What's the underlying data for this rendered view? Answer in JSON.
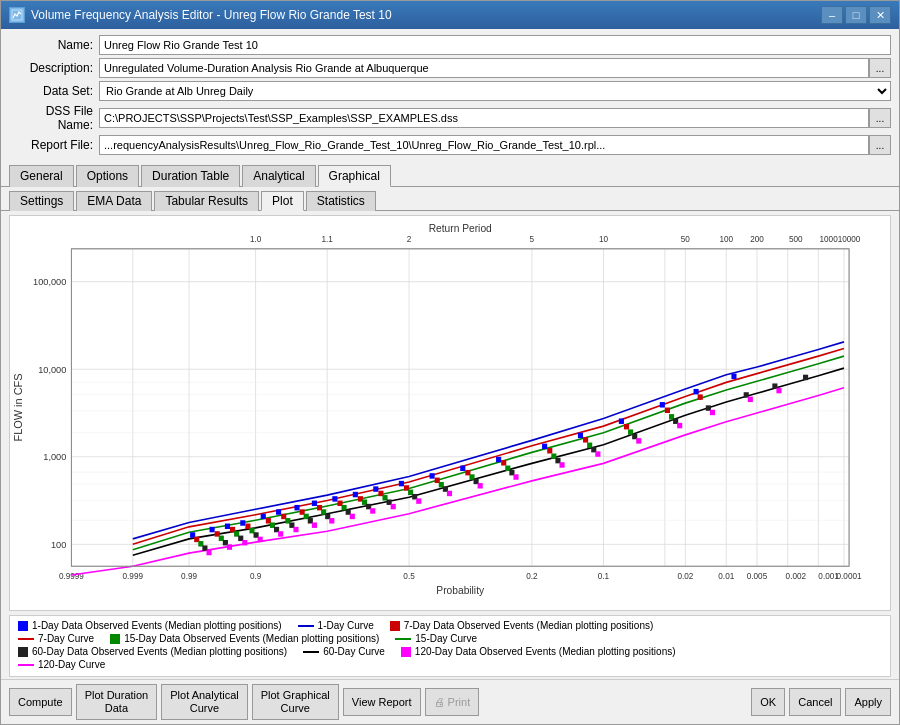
{
  "window": {
    "title": "Volume Frequency Analysis Editor - Unreg Flow Rio Grande Test 10",
    "icon": "chart-icon"
  },
  "form": {
    "name_label": "Name:",
    "name_value": "Unreg Flow Rio Grande Test 10",
    "description_label": "Description:",
    "description_value": "Unregulated Volume-Duration Analysis Rio Grande at Albuquerque",
    "dataset_label": "Data Set:",
    "dataset_value": "Rio Grande at Alb Unreg Daily",
    "dss_label": "DSS File Name:",
    "dss_value": "C:\\PROJECTS\\SSP\\Projects\\Test\\SSP_Examples\\SSP_EXAMPLES.dss",
    "report_label": "Report File:",
    "report_value": "...requencyAnalysisResults\\Unreg_Flow_Rio_Grande_Test_10\\Unreg_Flow_Rio_Grande_Test_10.rpl..."
  },
  "tabs": {
    "main": [
      {
        "id": "general",
        "label": "General"
      },
      {
        "id": "options",
        "label": "Options"
      },
      {
        "id": "duration",
        "label": "Duration Table"
      },
      {
        "id": "analytical",
        "label": "Analytical"
      },
      {
        "id": "graphical",
        "label": "Graphical",
        "active": true
      }
    ],
    "sub": [
      {
        "id": "settings",
        "label": "Settings"
      },
      {
        "id": "ema",
        "label": "EMA Data"
      },
      {
        "id": "tabular",
        "label": "Tabular Results"
      },
      {
        "id": "plot",
        "label": "Plot",
        "active": true
      },
      {
        "id": "statistics",
        "label": "Statistics"
      }
    ]
  },
  "chart": {
    "title_top": "Return Period",
    "title_left": "FLOW in CFS",
    "title_bottom": "Probability",
    "x_axis_top": [
      "1.0",
      "1.1",
      "2",
      "5",
      "10",
      "50",
      "100",
      "200",
      "500",
      "1000",
      "10000"
    ],
    "x_axis_bottom": [
      "0.9999",
      "0.999",
      "0.99",
      "0.9",
      "0.5",
      "0.2",
      "0.1",
      "0.02",
      "0.01",
      "0.005",
      "0.002",
      "0.001",
      "0.0001"
    ],
    "y_axis": [
      "100",
      "1,000",
      "10,000",
      "100,000"
    ]
  },
  "legend": {
    "items": [
      {
        "type": "square",
        "color": "#0000ff",
        "label": "1-Day Data Observed Events (Median plotting positions)"
      },
      {
        "type": "line",
        "color": "#0000ff",
        "label": "1-Day Curve"
      },
      {
        "type": "square",
        "color": "#cc0000",
        "label": "7-Day Data Observed Events (Median plotting positions)"
      },
      {
        "type": "line",
        "color": "#cc0000",
        "label": "7-Day Curve"
      },
      {
        "type": "square",
        "color": "#008800",
        "label": "15-Day Data Observed Events (Median plotting positions)"
      },
      {
        "type": "line",
        "color": "#008800",
        "label": "15-Day Curve"
      },
      {
        "type": "square",
        "color": "#000000",
        "label": "60-Day Data Observed Events (Median plotting positions)"
      },
      {
        "type": "line",
        "color": "#000000",
        "label": "60-Day Curve"
      },
      {
        "type": "square",
        "color": "#ff00ff",
        "label": "120-Day Data Observed Events (Median plotting positions)"
      },
      {
        "type": "line",
        "color": "#ff00ff",
        "label": "120-Day Curve"
      }
    ]
  },
  "buttons": {
    "compute": "Compute",
    "plot_duration": "Plot Duration\nData",
    "plot_analytical": "Plot Analytical\nCurve",
    "plot_graphical": "Plot Graphical\nCurve",
    "view_report": "View Report",
    "print": "🖨 Print",
    "ok": "OK",
    "cancel": "Cancel",
    "apply": "Apply"
  }
}
